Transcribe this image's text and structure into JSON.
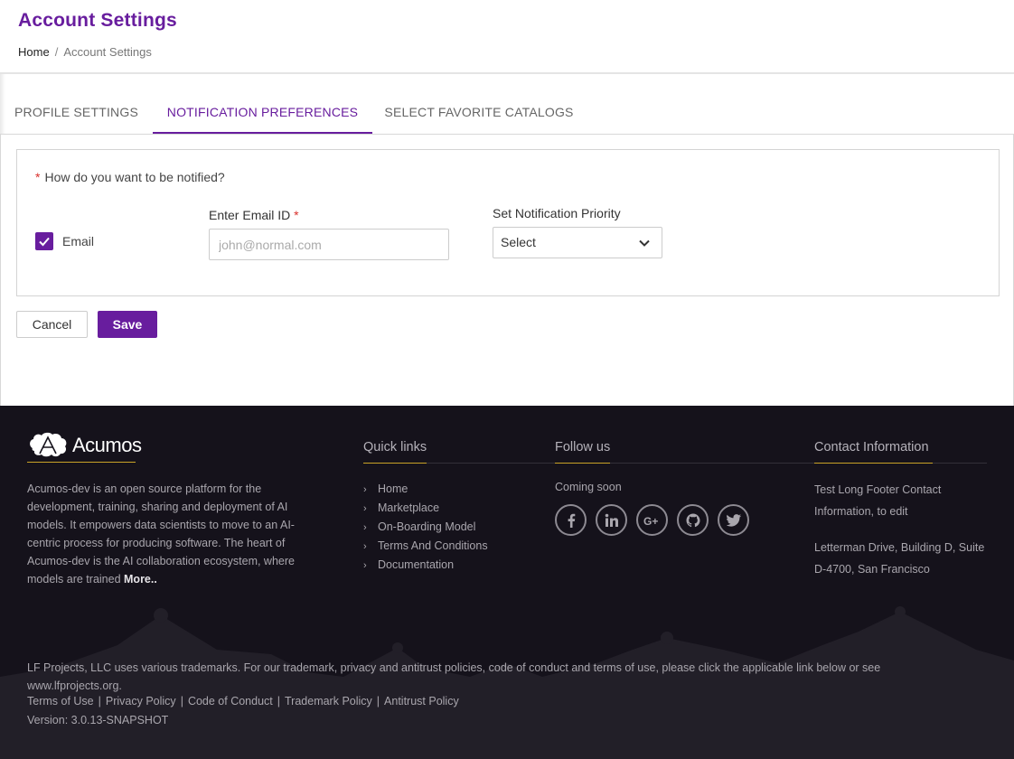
{
  "header": {
    "title": "Account Settings",
    "breadcrumb": {
      "home": "Home",
      "separator": "/",
      "current": "Account Settings"
    }
  },
  "tabs": [
    {
      "label": "PROFILE SETTINGS",
      "active": false
    },
    {
      "label": "NOTIFICATION PREFERENCES",
      "active": true
    },
    {
      "label": "SELECT FAVORITE CATALOGS",
      "active": false
    }
  ],
  "notification": {
    "required_marker": "*",
    "question": "How do you want to be notified?",
    "email_checkbox": {
      "label": "Email",
      "checked": true
    },
    "email_field": {
      "label": "Enter Email ID",
      "required_marker": "*",
      "placeholder": "john@normal.com",
      "value": ""
    },
    "priority": {
      "label": "Set Notification Priority",
      "selected": "Select"
    }
  },
  "actions": {
    "cancel": "Cancel",
    "save": "Save"
  },
  "footer": {
    "logo_text": "Acumos",
    "description": "Acumos-dev is an open source platform for the development, training, sharing and deployment of AI models. It empowers data scientists to move to an AI-centric process for producing software. The heart of Acumos-dev is the AI collaboration ecosystem, where models are trained",
    "more_link": "More..",
    "quick_links": {
      "heading": "Quick links",
      "items": [
        "Home",
        "Marketplace",
        "On-Boarding Model",
        "Terms And Conditions",
        "Documentation"
      ]
    },
    "follow_us": {
      "heading": "Follow us",
      "status": "Coming soon",
      "icons": [
        "facebook-icon",
        "linkedin-icon",
        "google-plus-icon",
        "github-icon",
        "twitter-icon"
      ]
    },
    "contact": {
      "heading": "Contact Information",
      "line1": "Test Long Footer Contact Information, to edit",
      "line2": "Letterman Drive, Building D, Suite D-4700, San Francisco"
    },
    "legal": "LF Projects, LLC uses various trademarks. For our trademark, privacy and antitrust policies, code of conduct and terms of use, please click the applicable link below or see www.lfprojects.org.",
    "legal_links": [
      "Terms of Use",
      "Privacy Policy",
      "Code of Conduct",
      "Trademark Policy",
      "Antitrust Policy"
    ],
    "version": "Version: 3.0.13-SNAPSHOT"
  },
  "colors": {
    "accent": "#681d9e",
    "required": "#d9302c",
    "footer_bg": "#15121b",
    "footer_underline": "#c9a227"
  }
}
